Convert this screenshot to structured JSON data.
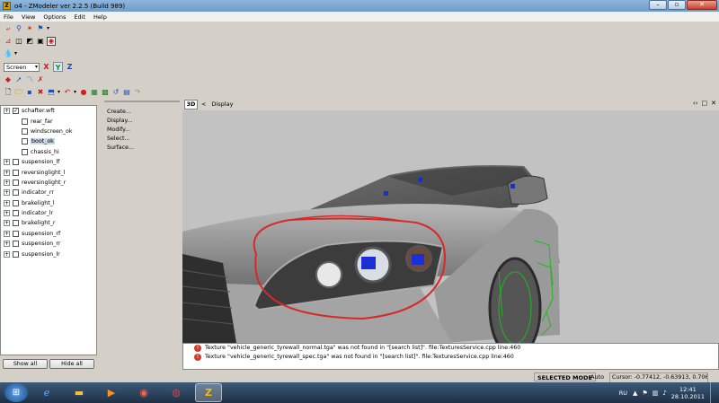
{
  "window": {
    "title": "o4 - ZModeler ver 2.2.5 (Build 989)",
    "app_icon": "Z",
    "controls": {
      "minimize": "–",
      "maximize": "▫",
      "close": "✕"
    }
  },
  "menu": [
    "File",
    "View",
    "Options",
    "Edit",
    "Help"
  ],
  "toolbar": {
    "view_mode": "Screen",
    "axes": [
      "X",
      "Y",
      "Z"
    ],
    "icons": [
      "select-icon",
      "move-icon",
      "rotate-icon",
      "scale-icon",
      "new-icon",
      "open-icon",
      "save-icon",
      "delete-icon",
      "undo-icon",
      "redo-icon",
      "record-icon",
      "render-icon",
      "material-icon"
    ]
  },
  "tree": {
    "items": [
      {
        "label": "schafter.wft",
        "checked": true,
        "expandable": true,
        "indent": false,
        "selected": false
      },
      {
        "label": "rear_far",
        "checked": false,
        "expandable": false,
        "indent": true,
        "selected": false
      },
      {
        "label": "windscreen_ok",
        "checked": false,
        "expandable": false,
        "indent": true,
        "selected": false
      },
      {
        "label": "boot_ok",
        "checked": false,
        "expandable": false,
        "indent": true,
        "selected": true
      },
      {
        "label": "chassis_hi",
        "checked": false,
        "expandable": false,
        "indent": true,
        "selected": false
      },
      {
        "label": "suspension_lf",
        "checked": false,
        "expandable": true,
        "indent": false,
        "selected": false
      },
      {
        "label": "reversinglight_l",
        "checked": false,
        "expandable": true,
        "indent": false,
        "selected": false
      },
      {
        "label": "reversinglight_r",
        "checked": false,
        "expandable": true,
        "indent": false,
        "selected": false
      },
      {
        "label": "indicator_rr",
        "checked": false,
        "expandable": true,
        "indent": false,
        "selected": false
      },
      {
        "label": "brakelight_l",
        "checked": false,
        "expandable": true,
        "indent": false,
        "selected": false
      },
      {
        "label": "indicator_lr",
        "checked": false,
        "expandable": true,
        "indent": false,
        "selected": false
      },
      {
        "label": "brakelight_r",
        "checked": false,
        "expandable": true,
        "indent": false,
        "selected": false
      },
      {
        "label": "suspension_rf",
        "checked": false,
        "expandable": true,
        "indent": false,
        "selected": false
      },
      {
        "label": "suspension_rr",
        "checked": false,
        "expandable": true,
        "indent": false,
        "selected": false
      },
      {
        "label": "suspension_lr",
        "checked": false,
        "expandable": true,
        "indent": false,
        "selected": false
      }
    ],
    "show_all": "Show all",
    "hide_all": "Hide all"
  },
  "commands": [
    "Create...",
    "Display...",
    "Modify...",
    "Select...",
    "Surface..."
  ],
  "viewport": {
    "mode_button": "3D",
    "label": "Display",
    "arrow": "<",
    "window_icons": [
      "‹›",
      "□",
      "✕"
    ]
  },
  "log": [
    "Texture \"vehicle_generic_tyrewall_normal.tga\" was not found in \"[search list]\". file:TexturesService.cpp line:460",
    "Texture \"vehicle_generic_tyrewall_spec.tga\" was not found in \"[search list]\". file:TexturesService.cpp line:460"
  ],
  "status": {
    "mode": "SELECTED MODE",
    "auto": "Auto",
    "cursor": "Cursor: -0.77412, -0.63913, 0.70640"
  },
  "taskbar": {
    "apps": [
      "ie-icon",
      "folder-icon",
      "media-icon",
      "map-icon",
      "chrome-icon",
      "zmodeler-icon"
    ],
    "language": "RU",
    "time": "12:41",
    "date": "28.10.2011"
  },
  "colors": {
    "marker_blue": "#1a2fd6",
    "annotation_red": "#d42a2a",
    "wire_green": "#1fb81f",
    "car_body": "#8a8a8a"
  }
}
